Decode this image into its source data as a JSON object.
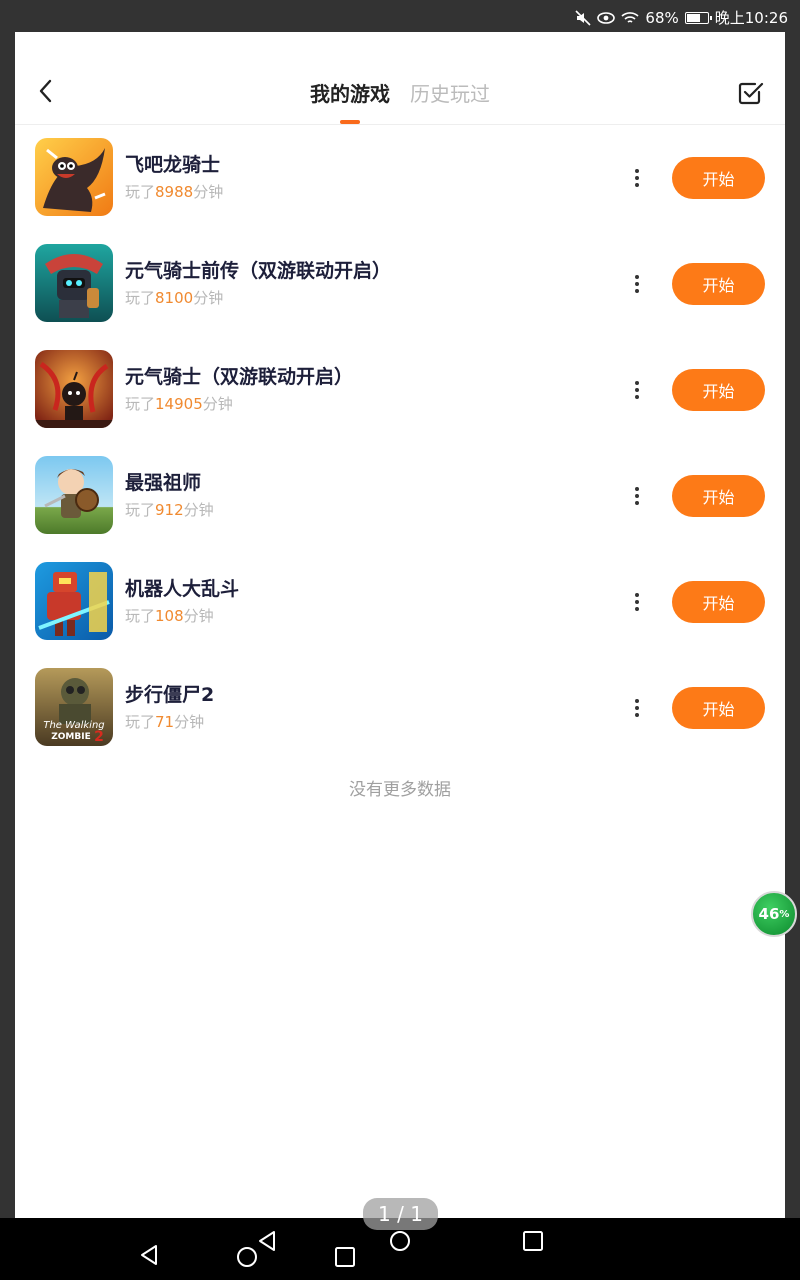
{
  "status_bar": {
    "battery_percent": "68%",
    "time": "晚上10:26",
    "icons": [
      "mute-icon",
      "eye-icon",
      "wifi-icon",
      "battery-icon"
    ]
  },
  "header": {
    "tabs": [
      {
        "label": "我的游戏",
        "active": true
      },
      {
        "label": "历史玩过",
        "active": false
      }
    ]
  },
  "colors": {
    "accent": "#fd7a17",
    "minutes_text": "#f08a30",
    "title_text": "#1d1f3a"
  },
  "games": [
    {
      "title": "飞吧龙骑士",
      "prefix": "玩了",
      "minutes": "8988",
      "suffix": "分钟",
      "button": "开始",
      "icon": "dragon-rider-icon"
    },
    {
      "title": "元气骑士前传（双游联动开启）",
      "prefix": "玩了",
      "minutes": "8100",
      "suffix": "分钟",
      "button": "开始",
      "icon": "soul-knight-prequel-icon"
    },
    {
      "title": "元气骑士（双游联动开启）",
      "prefix": "玩了",
      "minutes": "14905",
      "suffix": "分钟",
      "button": "开始",
      "icon": "soul-knight-icon"
    },
    {
      "title": "最强祖师",
      "prefix": "玩了",
      "minutes": "912",
      "suffix": "分钟",
      "button": "开始",
      "icon": "strongest-master-icon"
    },
    {
      "title": "机器人大乱斗",
      "prefix": "玩了",
      "minutes": "108",
      "suffix": "分钟",
      "button": "开始",
      "icon": "robot-brawl-icon"
    },
    {
      "title": "步行僵尸2",
      "prefix": "玩了",
      "minutes": "71",
      "suffix": "分钟",
      "button": "开始",
      "icon": "walking-zombie-icon",
      "icon_text": [
        "The Walking",
        "ZOMBIE",
        "2"
      ]
    }
  ],
  "no_more_text": "没有更多数据",
  "float_badge": {
    "value": "46",
    "unit": "%"
  },
  "page_indicator": "1 / 1"
}
